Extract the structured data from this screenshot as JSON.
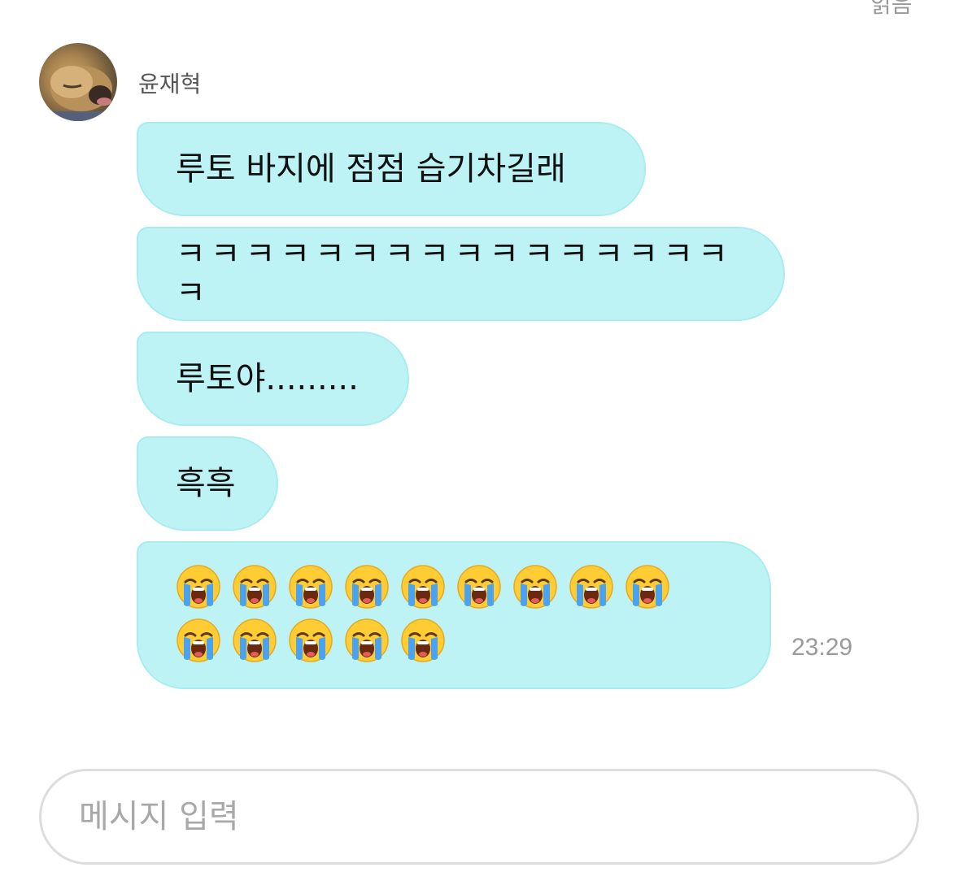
{
  "header": {
    "read_status": "읽음"
  },
  "sender": {
    "name": "윤재혁",
    "avatar_icon": "dog-photo-avatar"
  },
  "messages": [
    {
      "text": "루토 바지에 점점 습기차길래"
    },
    {
      "text": "ㅋㅋㅋㅋㅋㅋㅋㅋㅋㅋㅋㅋㅋㅋㅋㅋㅋ"
    },
    {
      "text": "루토야........."
    },
    {
      "text": "흑흑"
    },
    {
      "emoji": "loudly-crying-face",
      "count": 14
    }
  ],
  "timestamp": "23:29",
  "input": {
    "placeholder": "메시지 입력",
    "value": ""
  },
  "colors": {
    "bubble": "#bdf3f5",
    "bubble_border": "#a9ecf0",
    "emoji_face": "#ffcc33",
    "tears": "#4aa3f0"
  }
}
